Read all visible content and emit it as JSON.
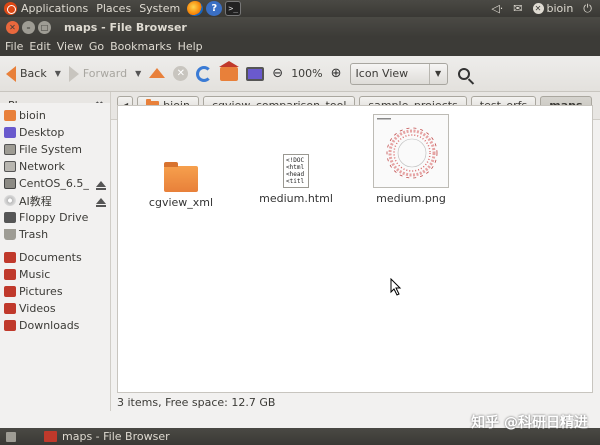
{
  "top_panel": {
    "menus": [
      "Applications",
      "Places",
      "System"
    ],
    "user": "bioin",
    "launchers": {
      "help": "?",
      "terminal": ">_"
    }
  },
  "window": {
    "title": "maps - File Browser"
  },
  "menubar": [
    "File",
    "Edit",
    "View",
    "Go",
    "Bookmarks",
    "Help"
  ],
  "toolbar": {
    "back_label": "Back",
    "forward_label": "Forward",
    "zoom_level": "100%",
    "view_mode": "Icon View"
  },
  "sidebar": {
    "header": "Places",
    "devices": [
      {
        "label": "bioin",
        "icon": "home-folder-icon"
      },
      {
        "label": "Desktop",
        "icon": "desktop-icon"
      },
      {
        "label": "File System",
        "icon": "filesystem-icon"
      },
      {
        "label": "Network",
        "icon": "network-icon"
      },
      {
        "label": "CentOS_6.5_",
        "icon": "drive-icon",
        "eject": true
      },
      {
        "label": "AI教程",
        "icon": "cdrom-icon",
        "eject": true
      },
      {
        "label": "Floppy Drive",
        "icon": "floppy-icon"
      },
      {
        "label": "Trash",
        "icon": "trash-icon"
      }
    ],
    "bookmarks": [
      {
        "label": "Documents",
        "icon": "folder-icon"
      },
      {
        "label": "Music",
        "icon": "folder-icon"
      },
      {
        "label": "Pictures",
        "icon": "folder-icon"
      },
      {
        "label": "Videos",
        "icon": "folder-icon"
      },
      {
        "label": "Downloads",
        "icon": "folder-icon"
      }
    ]
  },
  "breadcrumbs": [
    "bioin",
    "cgview_comparison_tool",
    "sample_projects",
    "test_orfs",
    "maps"
  ],
  "files": [
    {
      "name": "cgview_xml",
      "type": "folder"
    },
    {
      "name": "medium.html",
      "type": "html",
      "preview": "<!DOC\n<html\n<head\n<titl"
    },
    {
      "name": "medium.png",
      "type": "image"
    }
  ],
  "status": "3 items, Free space: 12.7 GB",
  "taskbar": {
    "task_label": "maps - File Browser"
  },
  "watermark": "知乎 @科研日精进",
  "colors": {
    "accent": "#e8803a",
    "panel": "#3c3b37",
    "close": "#e9683d"
  }
}
